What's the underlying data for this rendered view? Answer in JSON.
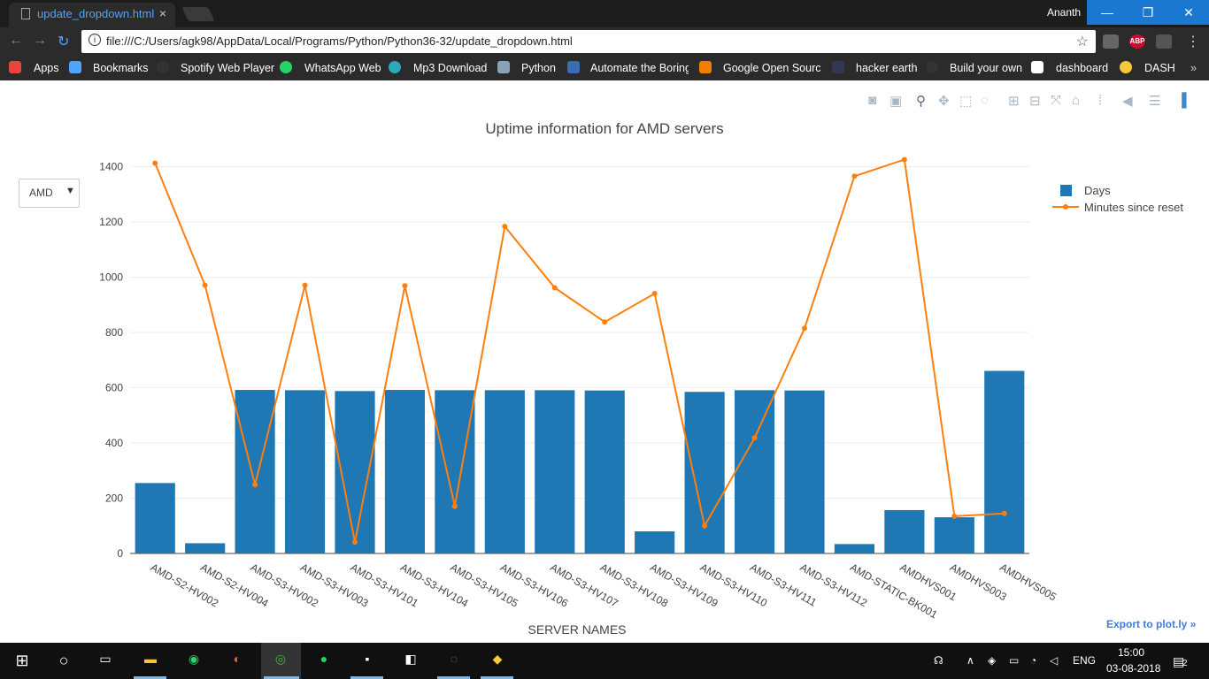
{
  "browser": {
    "tab_title": "update_dropdown.html",
    "tab_close": "×",
    "user_name": "Ananth",
    "window_buttons": {
      "minimize": "—",
      "restore": "❐",
      "close": "✕"
    },
    "url": "file:///C:/Users/agk98/AppData/Local/Programs/Python/Python36-32/update_dropdown.html",
    "nav": {
      "back": "←",
      "forward": "→",
      "reload": "↻"
    },
    "star": "☆",
    "extensions": [
      "ABP"
    ]
  },
  "bookmarks": [
    {
      "label": "Apps",
      "icon": "apps-grid-icon",
      "color": "#e8453c"
    },
    {
      "label": "Bookmarks",
      "icon": "star-icon",
      "color": "#4ea4ff"
    },
    {
      "label": "Spotify Web Player",
      "icon": "spotify-icon",
      "color": "#333333"
    },
    {
      "label": "WhatsApp Web",
      "icon": "whatsapp-icon",
      "color": "#25d366"
    },
    {
      "label": "Mp3 Download",
      "icon": "cloud-icon",
      "color": "#2aa9b8"
    },
    {
      "label": "Python",
      "icon": "python-doc-icon",
      "color": "#8aa2b8"
    },
    {
      "label": "Automate the Boring",
      "icon": "page-icon",
      "color": "#3b6db5"
    },
    {
      "label": "Google Open Source",
      "icon": "blogger-icon",
      "color": "#f57d00"
    },
    {
      "label": "hacker earth",
      "icon": "hackerearth-icon",
      "color": "#323754"
    },
    {
      "label": "Build your own",
      "icon": "github-icon",
      "color": "#333333"
    },
    {
      "label": "dashboard",
      "icon": "k-icon",
      "color": "#ffffff"
    },
    {
      "label": "DASH",
      "icon": "python-icon",
      "color": "#f7c83a"
    }
  ],
  "dropdown": {
    "value": "AMD",
    "arrow": "▼"
  },
  "export_link": "Export to plot.ly »",
  "chart_data": {
    "type": "bar+line",
    "title": "Uptime information for AMD servers",
    "xlabel": "SERVER NAMES",
    "ylabel": "",
    "ylim": [
      0,
      1450
    ],
    "yticks": [
      0,
      200,
      400,
      600,
      800,
      1000,
      1200,
      1400
    ],
    "grid": true,
    "legend_position": "top-right",
    "categories": [
      "AMD-S2-HV002",
      "AMD-S2-HV004",
      "AMD-S3-HV002",
      "AMD-S3-HV003",
      "AMD-S3-HV101",
      "AMD-S3-HV104",
      "AMD-S3-HV105",
      "AMD-S3-HV106",
      "AMD-S3-HV107",
      "AMD-S3-HV108",
      "AMD-S3-HV109",
      "AMD-S3-HV110",
      "AMD-S3-HV111",
      "AMD-S3-HV112",
      "AMD-STATIC-BK001",
      "AMDHVS001",
      "AMDHVS003",
      "AMDHVS005"
    ],
    "series": [
      {
        "name": "Days",
        "kind": "bar",
        "color": "#1f77b4",
        "values": [
          255,
          37,
          592,
          591,
          588,
          592,
          591,
          591,
          591,
          590,
          80,
          585,
          591,
          590,
          34,
          157,
          131,
          661
        ]
      },
      {
        "name": "Minutes since reset",
        "kind": "line",
        "color": "#ff7f0e",
        "values": [
          1413,
          971,
          249,
          971,
          41,
          969,
          171,
          1184,
          962,
          838,
          941,
          100,
          418,
          815,
          1366,
          1426,
          135,
          145
        ]
      }
    ]
  },
  "taskbar": {
    "language": "ENG",
    "time": "15:00",
    "date": "03-08-2018",
    "notifications": "2"
  }
}
